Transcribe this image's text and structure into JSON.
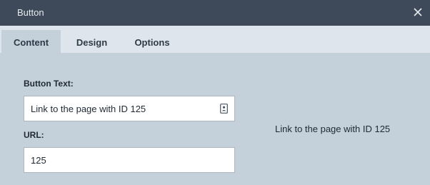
{
  "window": {
    "title": "Button"
  },
  "tabs": [
    {
      "label": "Content",
      "active": true
    },
    {
      "label": "Design",
      "active": false
    },
    {
      "label": "Options",
      "active": false
    }
  ],
  "form": {
    "button_text": {
      "label": "Button Text:",
      "value": "Link to the page with ID 125"
    },
    "url": {
      "label": "URL:",
      "value": "125"
    }
  },
  "preview": {
    "text": "Link to the page with ID 125"
  },
  "icons": {
    "close": "close-icon",
    "field_action": "contact-card-icon"
  },
  "colors": {
    "titlebar": "#3e4a59",
    "tabbar": "#dfe5ec",
    "panel": "#c4d0da"
  }
}
